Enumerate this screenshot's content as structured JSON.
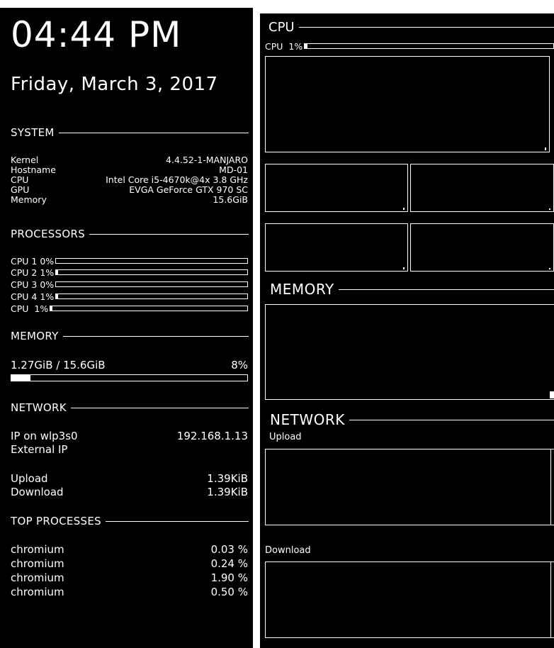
{
  "left": {
    "clock": "04:44 PM",
    "date": "Friday, March  3, 2017",
    "system": {
      "heading": "SYSTEM",
      "rows": [
        {
          "label": "Kernel",
          "value": "4.4.52-1-MANJARO"
        },
        {
          "label": "Hostname",
          "value": "MD-01"
        },
        {
          "label": "CPU",
          "value": "Intel Core i5-4670k@4x 3.8 GHz"
        },
        {
          "label": "GPU",
          "value": "EVGA GeForce GTX 970 SC"
        },
        {
          "label": "Memory",
          "value": "15.6GiB"
        }
      ]
    },
    "processors": {
      "heading": "PROCESSORS",
      "rows": [
        {
          "label": "CPU 1 0%",
          "percent": 0
        },
        {
          "label": "CPU 2 1%",
          "percent": 1
        },
        {
          "label": "CPU 3 0%",
          "percent": 0
        },
        {
          "label": "CPU 4 1%",
          "percent": 1
        },
        {
          "label": "CPU  1%",
          "percent": 1
        }
      ]
    },
    "memory": {
      "heading": "MEMORY",
      "usage": "1.27GiB / 15.6GiB",
      "percent_text": "8%",
      "percent": 8
    },
    "network": {
      "heading": "NETWORK",
      "ip_label": "IP on wlp3s0",
      "ip_value": "192.168.1.13",
      "external_label": "External IP",
      "external_value": "",
      "upload_label": "Upload",
      "upload_value": "1.39KiB",
      "download_label": "Download",
      "download_value": "1.39KiB"
    },
    "top_processes": {
      "heading": "TOP PROCESSES",
      "rows": [
        {
          "name": "chromium",
          "value": "0.03 %"
        },
        {
          "name": "chromium",
          "value": "0.24 %"
        },
        {
          "name": "chromium",
          "value": "1.90 %"
        },
        {
          "name": "chromium",
          "value": "0.50 %"
        }
      ]
    }
  },
  "right": {
    "cpu": {
      "heading": "CPU",
      "bar_label": "CPU  1%",
      "percent": 1
    },
    "memory": {
      "heading": "MEMORY"
    },
    "network": {
      "heading": "NETWORK",
      "upload_label": "Upload",
      "download_label": "Download"
    }
  }
}
